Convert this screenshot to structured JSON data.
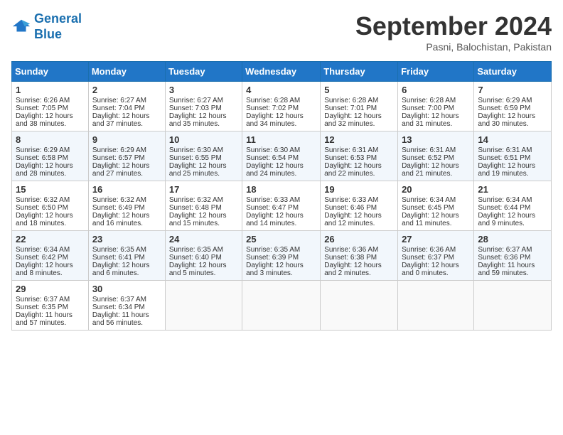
{
  "logo": {
    "line1": "General",
    "line2": "Blue"
  },
  "title": "September 2024",
  "location": "Pasni, Balochistan, Pakistan",
  "days_of_week": [
    "Sunday",
    "Monday",
    "Tuesday",
    "Wednesday",
    "Thursday",
    "Friday",
    "Saturday"
  ],
  "weeks": [
    [
      {
        "day": "1",
        "sunrise": "6:26 AM",
        "sunset": "7:05 PM",
        "daylight": "12 hours and 38 minutes."
      },
      {
        "day": "2",
        "sunrise": "6:27 AM",
        "sunset": "7:04 PM",
        "daylight": "12 hours and 37 minutes."
      },
      {
        "day": "3",
        "sunrise": "6:27 AM",
        "sunset": "7:03 PM",
        "daylight": "12 hours and 35 minutes."
      },
      {
        "day": "4",
        "sunrise": "6:28 AM",
        "sunset": "7:02 PM",
        "daylight": "12 hours and 34 minutes."
      },
      {
        "day": "5",
        "sunrise": "6:28 AM",
        "sunset": "7:01 PM",
        "daylight": "12 hours and 32 minutes."
      },
      {
        "day": "6",
        "sunrise": "6:28 AM",
        "sunset": "7:00 PM",
        "daylight": "12 hours and 31 minutes."
      },
      {
        "day": "7",
        "sunrise": "6:29 AM",
        "sunset": "6:59 PM",
        "daylight": "12 hours and 30 minutes."
      }
    ],
    [
      {
        "day": "8",
        "sunrise": "6:29 AM",
        "sunset": "6:58 PM",
        "daylight": "12 hours and 28 minutes."
      },
      {
        "day": "9",
        "sunrise": "6:29 AM",
        "sunset": "6:57 PM",
        "daylight": "12 hours and 27 minutes."
      },
      {
        "day": "10",
        "sunrise": "6:30 AM",
        "sunset": "6:55 PM",
        "daylight": "12 hours and 25 minutes."
      },
      {
        "day": "11",
        "sunrise": "6:30 AM",
        "sunset": "6:54 PM",
        "daylight": "12 hours and 24 minutes."
      },
      {
        "day": "12",
        "sunrise": "6:31 AM",
        "sunset": "6:53 PM",
        "daylight": "12 hours and 22 minutes."
      },
      {
        "day": "13",
        "sunrise": "6:31 AM",
        "sunset": "6:52 PM",
        "daylight": "12 hours and 21 minutes."
      },
      {
        "day": "14",
        "sunrise": "6:31 AM",
        "sunset": "6:51 PM",
        "daylight": "12 hours and 19 minutes."
      }
    ],
    [
      {
        "day": "15",
        "sunrise": "6:32 AM",
        "sunset": "6:50 PM",
        "daylight": "12 hours and 18 minutes."
      },
      {
        "day": "16",
        "sunrise": "6:32 AM",
        "sunset": "6:49 PM",
        "daylight": "12 hours and 16 minutes."
      },
      {
        "day": "17",
        "sunrise": "6:32 AM",
        "sunset": "6:48 PM",
        "daylight": "12 hours and 15 minutes."
      },
      {
        "day": "18",
        "sunrise": "6:33 AM",
        "sunset": "6:47 PM",
        "daylight": "12 hours and 14 minutes."
      },
      {
        "day": "19",
        "sunrise": "6:33 AM",
        "sunset": "6:46 PM",
        "daylight": "12 hours and 12 minutes."
      },
      {
        "day": "20",
        "sunrise": "6:34 AM",
        "sunset": "6:45 PM",
        "daylight": "12 hours and 11 minutes."
      },
      {
        "day": "21",
        "sunrise": "6:34 AM",
        "sunset": "6:44 PM",
        "daylight": "12 hours and 9 minutes."
      }
    ],
    [
      {
        "day": "22",
        "sunrise": "6:34 AM",
        "sunset": "6:42 PM",
        "daylight": "12 hours and 8 minutes."
      },
      {
        "day": "23",
        "sunrise": "6:35 AM",
        "sunset": "6:41 PM",
        "daylight": "12 hours and 6 minutes."
      },
      {
        "day": "24",
        "sunrise": "6:35 AM",
        "sunset": "6:40 PM",
        "daylight": "12 hours and 5 minutes."
      },
      {
        "day": "25",
        "sunrise": "6:35 AM",
        "sunset": "6:39 PM",
        "daylight": "12 hours and 3 minutes."
      },
      {
        "day": "26",
        "sunrise": "6:36 AM",
        "sunset": "6:38 PM",
        "daylight": "12 hours and 2 minutes."
      },
      {
        "day": "27",
        "sunrise": "6:36 AM",
        "sunset": "6:37 PM",
        "daylight": "12 hours and 0 minutes."
      },
      {
        "day": "28",
        "sunrise": "6:37 AM",
        "sunset": "6:36 PM",
        "daylight": "11 hours and 59 minutes."
      }
    ],
    [
      {
        "day": "29",
        "sunrise": "6:37 AM",
        "sunset": "6:35 PM",
        "daylight": "11 hours and 57 minutes."
      },
      {
        "day": "30",
        "sunrise": "6:37 AM",
        "sunset": "6:34 PM",
        "daylight": "11 hours and 56 minutes."
      },
      null,
      null,
      null,
      null,
      null
    ]
  ]
}
